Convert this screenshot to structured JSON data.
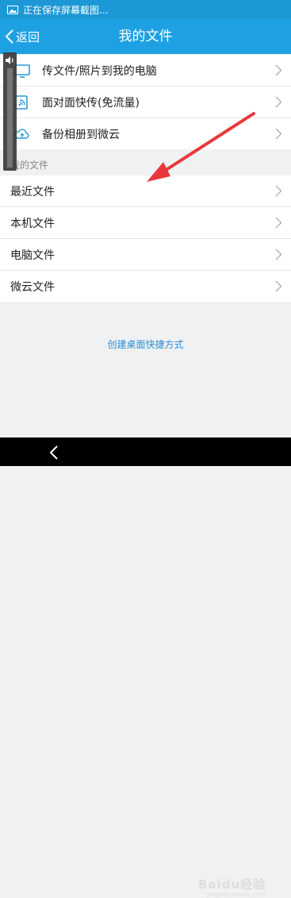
{
  "status_bar": {
    "text": "正在保存屏幕截图..."
  },
  "title_bar": {
    "back_label": "返回",
    "title": "我的文件"
  },
  "transfer_items": [
    {
      "label": "传文件/照片到我的电脑",
      "icon": "monitor-icon"
    },
    {
      "label": "面对面快传(免流量)",
      "icon": "wireless-transfer-icon"
    },
    {
      "label": "备份相册到微云",
      "icon": "cloud-icon"
    }
  ],
  "section_label": "我的文件",
  "file_items": [
    {
      "label": "最近文件"
    },
    {
      "label": "本机文件"
    },
    {
      "label": "电脑文件"
    },
    {
      "label": "微云文件"
    }
  ],
  "shortcut_link": "创建桌面快捷方式",
  "watermark": {
    "brand": "Baidu经验",
    "url": "jingyan.baidu.com"
  },
  "colors": {
    "title_bar": "#1ea1e3",
    "link": "#2a8ed3",
    "arrow": "#e8383c"
  }
}
